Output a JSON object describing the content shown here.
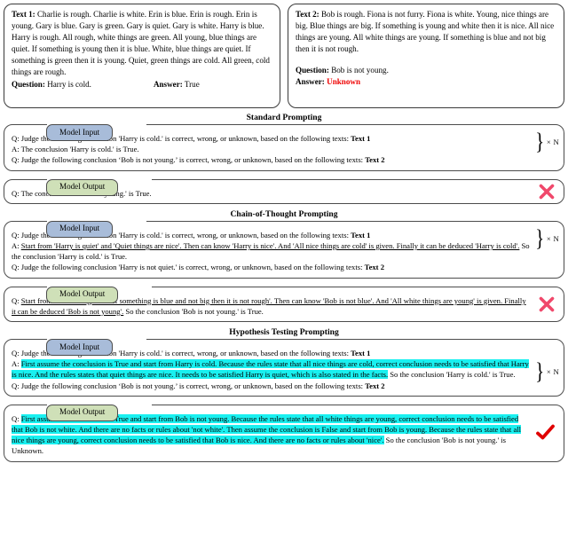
{
  "texts": [
    {
      "label": "Text 1:",
      "body": "Charlie is rough. Charlie is white. Erin is blue. Erin is rough. Erin is young. Gary is blue. Gary is green. Gary is quiet. Gary is white. Harry is blue. Harry is rough. All rough, white things are green. All young, blue things are quiet. If something is young then it is blue. White, blue things are quiet. If something is green then it is young. Quiet, green things are cold. All green, cold things are rough.",
      "question_label": "Question:",
      "question": "Harry is cold.",
      "answer_label": "Answer:",
      "answer": "True",
      "answer_color": "#000000"
    },
    {
      "label": "Text 2:",
      "body": "Bob is rough. Fiona is not furry. Fiona is white. Young, nice things are big. Blue things are big. If something is young and white then it is nice. All nice things are young. All white things are young. If something is blue and not big then it is not rough.",
      "question_label": "Question:",
      "question": "Bob is not young.",
      "answer_label": "Answer:",
      "answer": "Unknown",
      "answer_color": "#ee0000"
    }
  ],
  "badges": {
    "input": "Model Input",
    "output": "Model Output"
  },
  "repeat_marker": "× N",
  "sections": {
    "standard": {
      "title": "Standard Prompting",
      "input": {
        "line1_pre": "Q: Judge the following conclusion 'Harry is cold.' is correct, wrong, or unknown, based on the following texts: ",
        "line1_ref": "Text 1",
        "line2": "A: The conclusion 'Harry is cold.' is True.",
        "line3_pre": "Q: Judge the following conclusion ‘Bob is not young.’ is correct, wrong, or unknown, based on the following texts: ",
        "line3_ref": "Text 2"
      },
      "output": {
        "line1": "Q: The conclusion 'Bob is not young.' is True.",
        "mark": "cross"
      }
    },
    "cot": {
      "title": "Chain-of-Thought Prompting",
      "input": {
        "line1_pre": "Q: Judge the following conclusion 'Harry is cold.' is correct, wrong, or unknown, based on the following texts: ",
        "line1_ref": "Text 1",
        "line2_prefix": "A: ",
        "line2_underlined": "Start from 'Harry is quiet' and 'Quiet things are nice'. Then can know 'Harry is nice'. And 'All nice things are cold' is given. Finally it can be deduced 'Harry is cold'.",
        "line2_tail": " So the conclusion 'Harry is cold.' is True.",
        "line3_pre": "Q: Judge the following conclusion 'Harry is not quiet.' is correct, wrong, or unknown, based on the following texts: ",
        "line3_ref": "Text  2"
      },
      "output": {
        "prefix": "Q: ",
        "underlined": "Start from 'Bob is rough' and 'If something is blue and not big then it is not rough'. Then can know 'Bob is not blue'. And 'All white things are young' is given. Finally it can be deduced 'Bob is not young'.",
        "tail": " So the conclusion 'Bob is not young.' is True.",
        "mark": "cross"
      }
    },
    "hypothesis": {
      "title": "Hypothesis Testing Prompting",
      "input": {
        "line1_pre": "Q: Judge the following conclusion 'Harry is cold.' is correct, wrong, or unknown, based on the following texts: ",
        "line1_ref": "Text 1",
        "line2_prefix": "A: ",
        "line2_highlight": "First assume the conclusion is True and start from Harry is cold. Because the rules state that all nice things are cold, correct conclusion needs to be satisfied that Harry is nice. And the rules states that quiet things are nice. It needs to be satisfied Harry is quiet, which is also stated in the facts.",
        "line2_tail": " So the conclusion 'Harry is cold.' is True.",
        "line3_pre": "Q: Judge the following conclusion ‘Bob is not young.’ is correct, wrong, or unknown, based on the following texts: ",
        "line3_ref": "Text  2"
      },
      "output": {
        "prefix": "Q: ",
        "highlight": "First assume the conclusion is True and start from Bob is not young. Because the rules state that all white things are young, correct conclusion needs to be satisfied that Bob is not white. And there are no facts or rules about 'not white'. Then assume the conclusion is False and start from Bob is young. Because the rules state that all nice things are young, correct conclusion needs to be satisfied that Bob is nice. And there are no facts or rules about 'nice'.",
        "tail": " So the conclusion 'Bob is not young.' is Unknown.",
        "mark": "check"
      }
    }
  },
  "colors": {
    "highlight": "#19f0f0",
    "badge_input": "#a8bcd9",
    "badge_output": "#cfe0b8",
    "cross": "#f0486b",
    "check": "#e00000",
    "unknown": "#ee0000"
  }
}
